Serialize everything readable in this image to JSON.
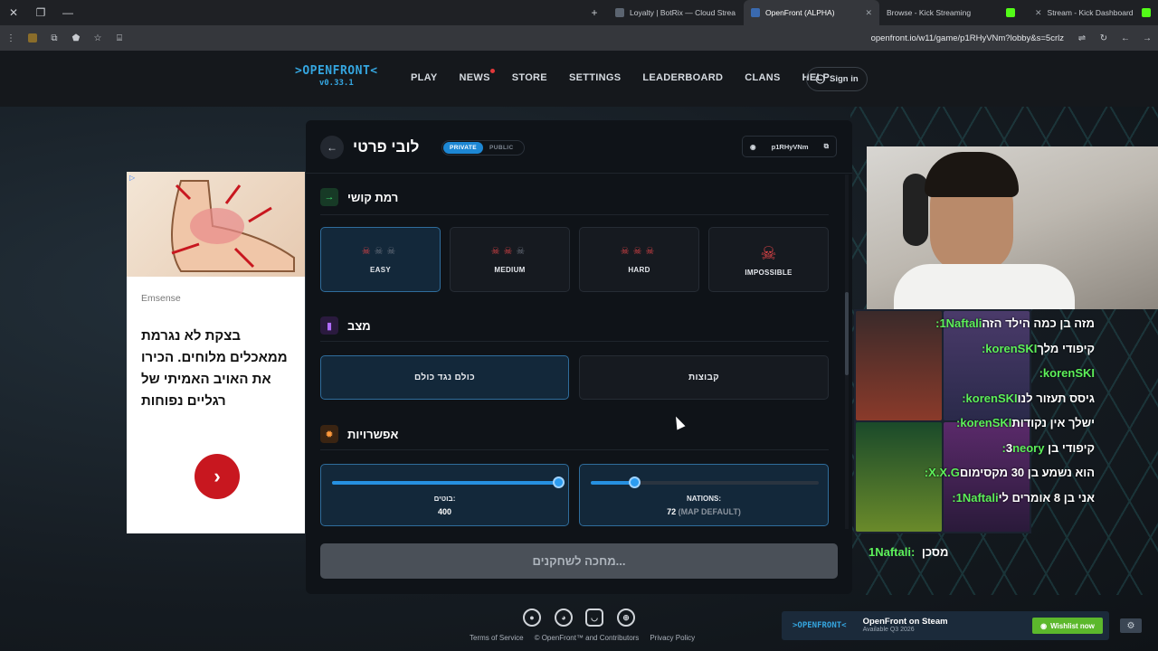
{
  "browser": {
    "tabs": [
      {
        "title": "Loyalty | BotRix — Cloud Strea",
        "active": false
      },
      {
        "title": "OpenFront (ALPHA)",
        "active": true
      },
      {
        "title": "Browse - Kick Streaming",
        "active": false
      },
      {
        "title": "Stream - Kick Dashboard",
        "active": false
      }
    ],
    "url": "openfront.io/w11/game/p1RHyVNm?lobby&s=5crlz"
  },
  "nav": {
    "logo_line1": ">OPENFRONT<",
    "logo_line2": "v0.33.1",
    "links": [
      "PLAY",
      "NEWS",
      "STORE",
      "SETTINGS",
      "LEADERBOARD",
      "CLANS",
      "HELP"
    ],
    "signin": "Sign in"
  },
  "ad": {
    "brand": "Emsense",
    "text": "בצקת לא נגרמת ממאכלים מלוחים. הכירו את האויב האמיתי של רגליים נפוחות",
    "info": "▷"
  },
  "lobby": {
    "title": "לובי פרטי",
    "visibility": {
      "private": "PRIVATE",
      "public": "PUBLIC",
      "selected": "PRIVATE"
    },
    "lobby_id": "p1RHyVNm",
    "difficulty": {
      "title": "רמת קושי",
      "options": [
        {
          "label": "EASY",
          "skulls": 1
        },
        {
          "label": "MEDIUM",
          "skulls": 2
        },
        {
          "label": "HARD",
          "skulls": 3
        },
        {
          "label": "IMPOSSIBLE",
          "skulls": 4
        }
      ],
      "selected": "EASY"
    },
    "mode": {
      "title": "מצב",
      "options": [
        "כולם נגד כולם",
        "קבוצות"
      ],
      "selected": "כולם נגד כולם"
    },
    "options": {
      "title": "אפשרויות",
      "bots": {
        "label": "בוטים:",
        "value": "400",
        "fraction": 1.0
      },
      "nations": {
        "label": "NATIONS:",
        "value": "72",
        "note": "(MAP DEFAULT)",
        "fraction": 0.19
      }
    },
    "wait_button": "מחכה לשחקנים..."
  },
  "chat": [
    {
      "user": "1Naftali:",
      "text": "מזה בן כמה הילד הזה"
    },
    {
      "user": "korenSKI:",
      "text": "קיפודי מלך"
    },
    {
      "user": "korenSKI:",
      "text": ""
    },
    {
      "user": "korenSKI:",
      "text": "גיסס תעזור לנו"
    },
    {
      "user": "korenSKI:",
      "text": "ישלך אין נקודות"
    },
    {
      "user": "neory:",
      "text": "קיפודי בן 3"
    },
    {
      "user": "X.X.G:",
      "text": "הוא נשמע בן 30 מקסימום"
    },
    {
      "user": "1Naftali:",
      "text": "אני בן 8 אומרים לי"
    }
  ],
  "chat_last": {
    "user": "1Naftali:",
    "text": "מסכן"
  },
  "footer": {
    "links": [
      "Terms of Service",
      "© OpenFront™ and Contributors",
      "Privacy Policy"
    ],
    "social_icons": [
      "github-icon",
      "reddit-icon",
      "discord-icon",
      "globe-icon"
    ]
  },
  "steam": {
    "logo": ">OPENFRONT<",
    "title": "OpenFront on Steam",
    "subtitle": "Available Q3 2026",
    "button": "Wishlist now"
  },
  "colors": {
    "accent": "#1d87d4",
    "danger": "#e04447",
    "steam_green": "#5cb82c"
  }
}
